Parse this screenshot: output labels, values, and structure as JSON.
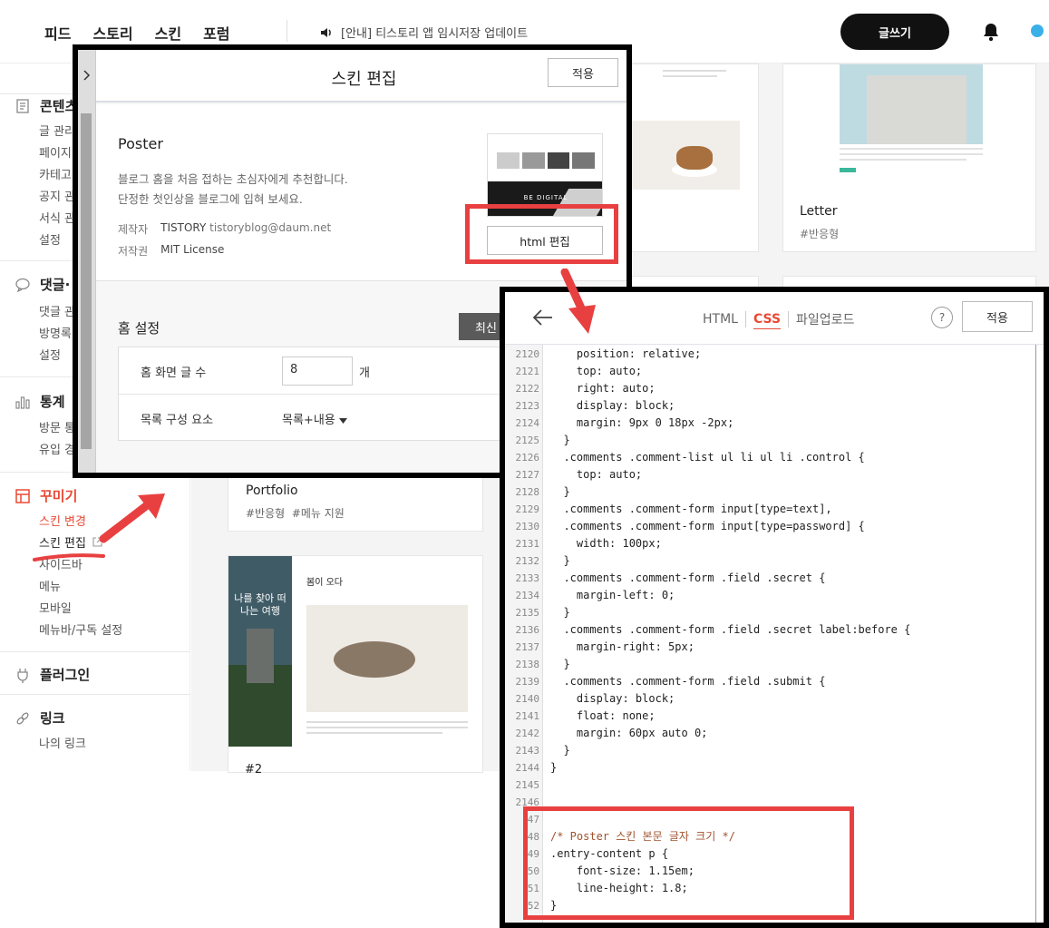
{
  "topnav": {
    "links": [
      "피드",
      "스토리",
      "스킨",
      "포럼"
    ],
    "notice": "[안내] 티스토리 앱 임시저장 업데이트",
    "write_button": "글쓰기"
  },
  "sidebar": {
    "content_title": "콘텐츠",
    "content_items": [
      "글 관리",
      "페이지",
      "카테고",
      "공지 관",
      "서식 관",
      "설정"
    ],
    "comment_title": "댓글·",
    "comment_items": [
      "댓글 관",
      "방명록",
      "설정"
    ],
    "stats_title": "통계",
    "stats_items": [
      "방문 통",
      "유입 경"
    ],
    "deco_title": "꾸미기",
    "deco_items": [
      "스킨 변경",
      "스킨 편집",
      "사이드바",
      "메뉴",
      "모바일",
      "메뉴바/구독 설정"
    ],
    "plugin_title": "플러그인",
    "link_title": "링크",
    "link_items": [
      "나의 링크"
    ]
  },
  "skins": {
    "letter_name": "Letter",
    "letter_tags": "#반응형",
    "portfolio_name": "Portfolio",
    "portfolio_tags": "#반응형  #메뉴 지원",
    "card2_title": "#2",
    "preview_heading": "봄이 오다",
    "preview_side_text": "나를 찾아 떠나는 여행"
  },
  "skin_edit": {
    "title": "스킨 편집",
    "apply": "적용",
    "skin_name": "Poster",
    "desc_line1": "블로그 홈을 처음 접하는 초심자에게 추천합니다.",
    "desc_line2": "단정한 첫인상을 블로그에 입혀 보세요.",
    "maker_label": "제작자",
    "maker_name": "TISTORY",
    "maker_email": "tistoryblog@daum.net",
    "license_label": "저작권",
    "license_value": "MIT License",
    "thumb_caption": "BE DIGITAL",
    "html_edit": "html 편집",
    "home_settings": "홈 설정",
    "latest": "최신",
    "post_count_label": "홈 화면 글 수",
    "post_count_value": "8",
    "post_count_unit": "개",
    "list_label": "목록 구성 요소",
    "list_value": "목록+내용"
  },
  "editor": {
    "tab_html": "HTML",
    "tab_css": "CSS",
    "tab_upload": "파일업로드",
    "help": "?",
    "apply": "적용",
    "lines": [
      {
        "n": "2120",
        "t": "    position: relative;"
      },
      {
        "n": "2121",
        "t": "    top: auto;"
      },
      {
        "n": "2122",
        "t": "    right: auto;"
      },
      {
        "n": "2123",
        "t": "    display: block;"
      },
      {
        "n": "2124",
        "t": "    margin: 9px 0 18px -2px;"
      },
      {
        "n": "2125",
        "t": "  }"
      },
      {
        "n": "2126",
        "t": "  .comments .comment-list ul li ul li .control {"
      },
      {
        "n": "2127",
        "t": "    top: auto;"
      },
      {
        "n": "2128",
        "t": "  }"
      },
      {
        "n": "2129",
        "t": "  .comments .comment-form input[type=text],"
      },
      {
        "n": "2130",
        "t": "  .comments .comment-form input[type=password] {"
      },
      {
        "n": "2131",
        "t": "    width: 100px;"
      },
      {
        "n": "2132",
        "t": "  }"
      },
      {
        "n": "2133",
        "t": "  .comments .comment-form .field .secret {"
      },
      {
        "n": "2134",
        "t": "    margin-left: 0;"
      },
      {
        "n": "2135",
        "t": "  }"
      },
      {
        "n": "2136",
        "t": "  .comments .comment-form .field .secret label:before {"
      },
      {
        "n": "2137",
        "t": "    margin-right: 5px;"
      },
      {
        "n": "2138",
        "t": "  }"
      },
      {
        "n": "2139",
        "t": "  .comments .comment-form .field .submit {"
      },
      {
        "n": "2140",
        "t": "    display: block;"
      },
      {
        "n": "2141",
        "t": "    float: none;"
      },
      {
        "n": "2142",
        "t": "    margin: 60px auto 0;"
      },
      {
        "n": "2143",
        "t": "  }"
      },
      {
        "n": "2144",
        "t": "}"
      },
      {
        "n": "2145",
        "t": ""
      },
      {
        "n": "2146",
        "t": ""
      },
      {
        "n": "47",
        "t": ""
      },
      {
        "n": "48",
        "t": "/* Poster 스킨 본문 글자 크기 */"
      },
      {
        "n": "49",
        "t": ".entry-content p {"
      },
      {
        "n": "50",
        "t": "    font-size: 1.15em;"
      },
      {
        "n": "51",
        "t": "    line-height: 1.8;"
      },
      {
        "n": "52",
        "t": "}"
      }
    ]
  },
  "colors": {
    "accent": "#e84a35",
    "highlight_box": "#e84040",
    "write_button_bg": "#111111"
  }
}
